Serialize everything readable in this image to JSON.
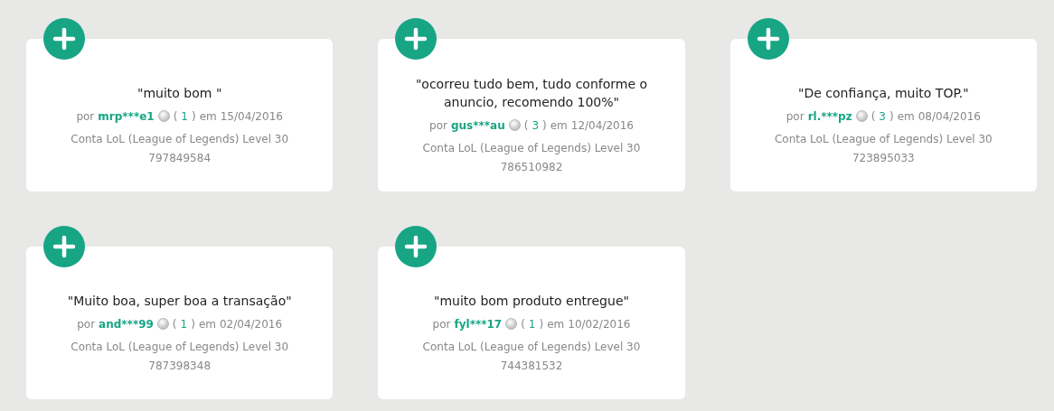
{
  "reviews": [
    {
      "quote": "\"muito bom \"",
      "by_label": "por",
      "user": "mrp***e1",
      "rating": {
        "open": "(",
        "value": "1",
        "close": ")"
      },
      "date_label": "em",
      "date": "15/04/2016",
      "product": "Conta LoL (League of Legends) Level 30",
      "code": "797849584"
    },
    {
      "quote": "\"ocorreu tudo bem, tudo conforme o anuncio, recomendo 100%\"",
      "by_label": "por",
      "user": "gus***au",
      "rating": {
        "open": "(",
        "value": "3",
        "close": ")"
      },
      "date_label": "em",
      "date": "12/04/2016",
      "product": "Conta LoL (League of Legends) Level 30",
      "code": "786510982"
    },
    {
      "quote": "\"De confiança, muito TOP.\"",
      "by_label": "por",
      "user": "rl.***pz",
      "rating": {
        "open": "(",
        "value": "3",
        "close": ")"
      },
      "date_label": "em",
      "date": "08/04/2016",
      "product": "Conta LoL (League of Legends) Level 30",
      "code": "723895033"
    },
    {
      "quote": "\"Muito boa, super boa a transação\"",
      "by_label": "por",
      "user": "and***99",
      "rating": {
        "open": "(",
        "value": "1",
        "close": ")"
      },
      "date_label": "em",
      "date": "02/04/2016",
      "product": "Conta LoL (League of Legends) Level 30",
      "code": "787398348"
    },
    {
      "quote": "\"muito bom produto entregue\"",
      "by_label": "por",
      "user": "fyl***17",
      "rating": {
        "open": "(",
        "value": "1",
        "close": ")"
      },
      "date_label": "em",
      "date": "10/02/2016",
      "product": "Conta LoL (League of Legends) Level 30",
      "code": "744381532"
    }
  ]
}
